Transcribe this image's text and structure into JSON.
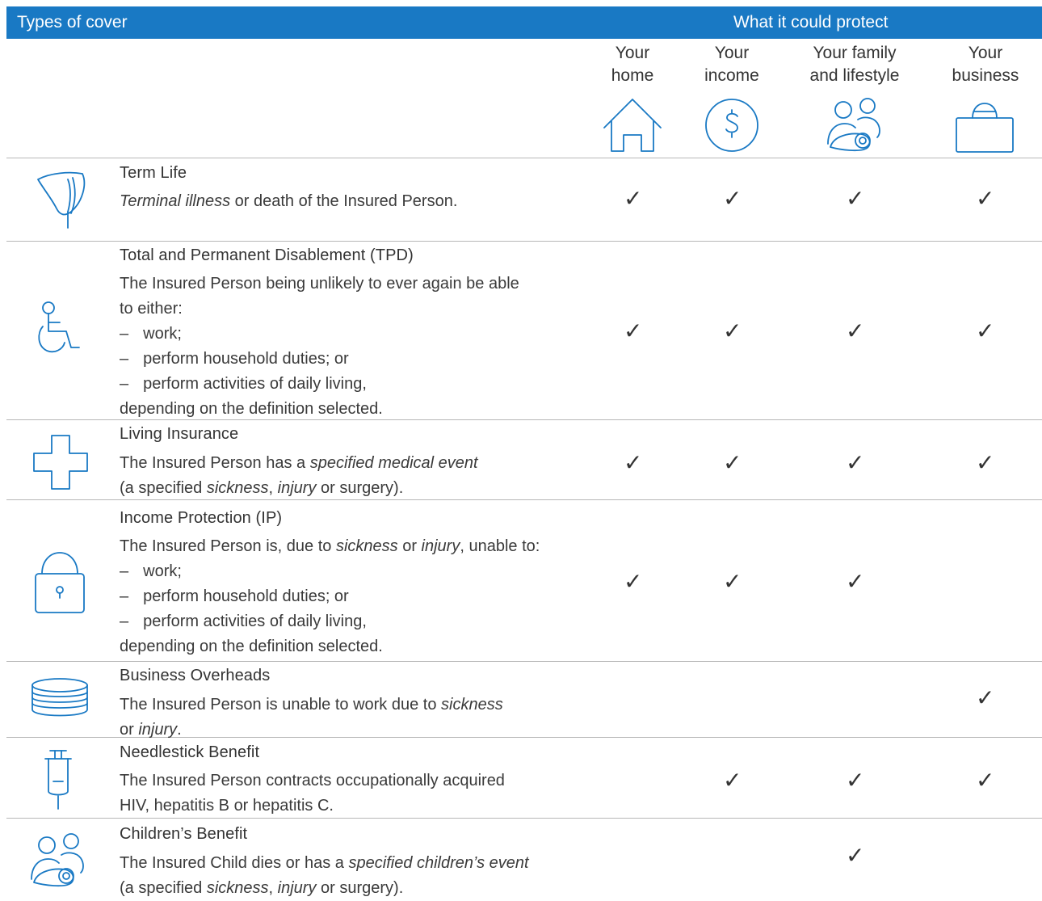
{
  "header": {
    "left": "Types of cover",
    "right": "What it could protect"
  },
  "columns": [
    {
      "line1": "Your",
      "line2": "home",
      "icon": "house-icon"
    },
    {
      "line1": "Your",
      "line2": "income",
      "icon": "dollar-icon"
    },
    {
      "line1": "Your family",
      "line2": "and lifestyle",
      "icon": "family-icon"
    },
    {
      "line1": "Your",
      "line2": "business",
      "icon": "briefcase-icon"
    }
  ],
  "check": "✓",
  "rows": [
    {
      "title": "Term Life",
      "icon": "lily-icon",
      "lines": [
        {
          "p": [
            {
              "t": "Terminal illness",
              "i": true
            },
            {
              "t": " or death of the Insured Person."
            }
          ]
        }
      ],
      "checks": [
        true,
        true,
        true,
        true
      ]
    },
    {
      "title": "Total and Permanent Disablement (TPD)",
      "icon": "wheelchair-icon",
      "lines": [
        {
          "p": [
            {
              "t": "The Insured Person being unlikely to ever again be able"
            }
          ]
        },
        {
          "p": [
            {
              "t": "to either:"
            }
          ]
        },
        {
          "dash": "–",
          "p": [
            {
              "t": "work;"
            }
          ]
        },
        {
          "dash": "–",
          "p": [
            {
              "t": "perform household duties; or"
            }
          ]
        },
        {
          "dash": "–",
          "p": [
            {
              "t": "perform activities of daily living,"
            }
          ]
        },
        {
          "p": [
            {
              "t": "depending on the definition selected."
            }
          ]
        }
      ],
      "checks": [
        true,
        true,
        true,
        true
      ]
    },
    {
      "title": "Living Insurance",
      "icon": "medical-cross-icon",
      "lines": [
        {
          "p": [
            {
              "t": "The Insured Person has a "
            },
            {
              "t": "specified medical event",
              "i": true
            }
          ]
        },
        {
          "p": [
            {
              "t": "(a specified "
            },
            {
              "t": "sickness",
              "i": true
            },
            {
              "t": ", "
            },
            {
              "t": "injury",
              "i": true
            },
            {
              "t": " or surgery)."
            }
          ]
        }
      ],
      "checks": [
        true,
        true,
        true,
        true
      ]
    },
    {
      "title": "Income Protection (IP)",
      "icon": "padlock-icon",
      "lines": [
        {
          "p": [
            {
              "t": "The Insured Person is, due to "
            },
            {
              "t": "sickness",
              "i": true
            },
            {
              "t": " or "
            },
            {
              "t": "injury",
              "i": true
            },
            {
              "t": ", unable to:"
            }
          ]
        },
        {
          "dash": "–",
          "p": [
            {
              "t": "work;"
            }
          ]
        },
        {
          "dash": "–",
          "p": [
            {
              "t": "perform household duties; or"
            }
          ]
        },
        {
          "dash": "–",
          "p": [
            {
              "t": "perform activities of daily living,"
            }
          ]
        },
        {
          "p": [
            {
              "t": "depending on the definition selected."
            }
          ]
        }
      ],
      "checks": [
        true,
        true,
        true,
        false
      ]
    },
    {
      "title": "Business Overheads",
      "icon": "coin-stack-icon",
      "lines": [
        {
          "p": [
            {
              "t": "The Insured Person is unable to work due to "
            },
            {
              "t": "sickness",
              "i": true
            }
          ]
        },
        {
          "p": [
            {
              "t": "or "
            },
            {
              "t": "injury",
              "i": true
            },
            {
              "t": "."
            }
          ]
        }
      ],
      "checks": [
        false,
        false,
        false,
        true
      ]
    },
    {
      "title": "Needlestick Benefit",
      "icon": "syringe-icon",
      "lines": [
        {
          "p": [
            {
              "t": "The Insured Person contracts occupationally acquired"
            }
          ]
        },
        {
          "p": [
            {
              "t": "HIV, hepatitis B or hepatitis C."
            }
          ]
        }
      ],
      "checks": [
        false,
        true,
        true,
        true
      ]
    },
    {
      "title": "Children’s Benefit",
      "icon": "family-icon",
      "lines": [
        {
          "p": [
            {
              "t": "The Insured Child dies or has a "
            },
            {
              "t": "specified children’s event",
              "i": true
            }
          ]
        },
        {
          "p": [
            {
              "t": "(a specified "
            },
            {
              "t": "sickness",
              "i": true
            },
            {
              "t": ", "
            },
            {
              "t": "injury",
              "i": true
            },
            {
              "t": " or surgery)."
            }
          ]
        }
      ],
      "checks": [
        false,
        false,
        true,
        false
      ]
    }
  ]
}
